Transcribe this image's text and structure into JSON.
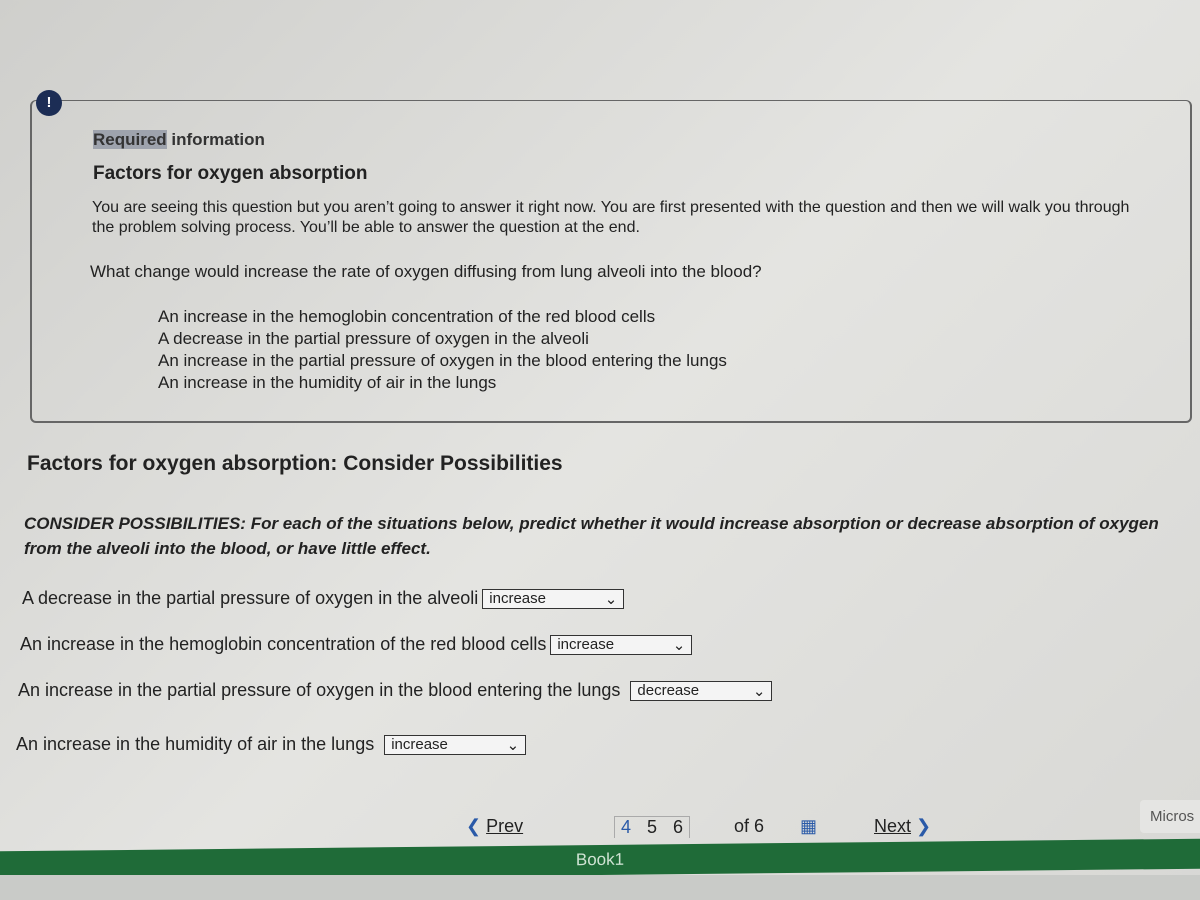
{
  "info": {
    "alert": "!",
    "label_hl": "Required",
    "label_rest": " information",
    "title": "Factors for oxygen absorption",
    "intro": "You are seeing this question but you aren’t going to answer it right now. You are first presented with the question and then we will walk you through the problem solving process. You’ll be able to answer the question at the end.",
    "question": "What change would increase the rate of oxygen diffusing from lung alveoli into the blood?",
    "options": [
      "An increase in the hemoglobin concentration of the red blood cells",
      "A decrease in the partial pressure of oxygen in the alveoli",
      "An increase in the partial pressure of oxygen in the blood entering the lungs",
      "An increase in the humidity of air in the lungs"
    ]
  },
  "section": {
    "title": "Factors for oxygen absorption: Consider Possibilities",
    "instructions": "CONSIDER POSSIBILITIES: For each of the situations below, predict whether it would increase absorption or decrease absorption of oxygen from the alveoli into the blood, or have little effect.",
    "items": [
      {
        "text": "A decrease in the partial pressure of oxygen in the alveoli",
        "value": "increase"
      },
      {
        "text": "An increase in the hemoglobin concentration of the red blood cells",
        "value": "increase"
      },
      {
        "text": "An increase in the partial pressure of oxygen in the blood entering the lungs",
        "value": "decrease"
      },
      {
        "text": "An increase in the humidity of air in the lungs",
        "value": "increase"
      }
    ]
  },
  "pager": {
    "prev": "Prev",
    "pages": [
      "4",
      "5",
      "6"
    ],
    "of": "of 6",
    "next": "Next"
  },
  "corner": "Micros",
  "excel": {
    "title": "Book1"
  },
  "colors": {
    "accent": "#1c2d55",
    "excel_green": "#1f6b38"
  }
}
